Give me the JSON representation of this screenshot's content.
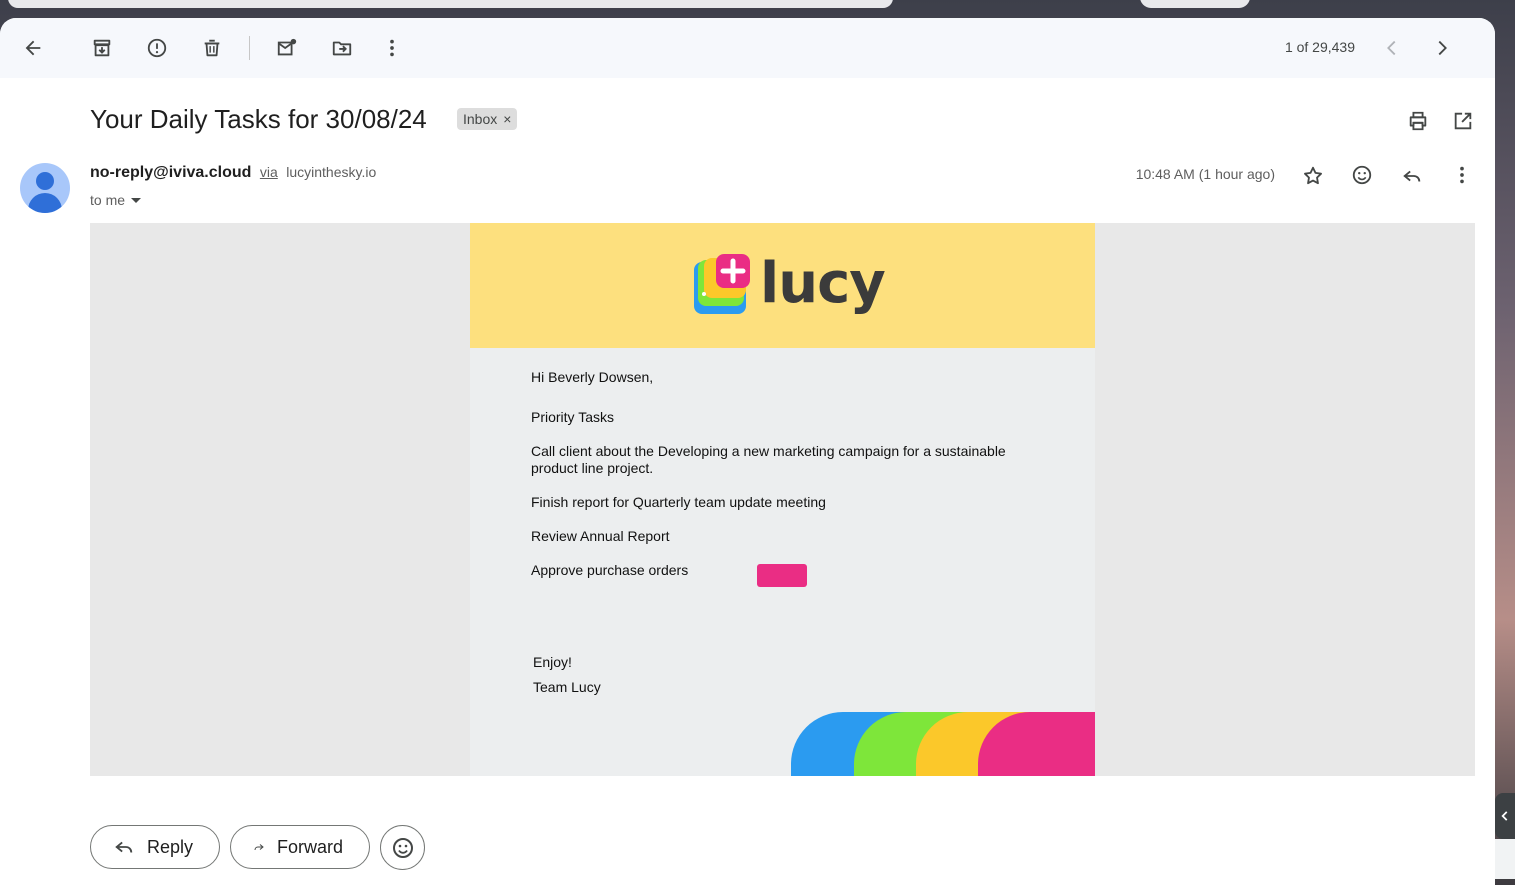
{
  "toolbar": {
    "back": "back-arrow-icon",
    "archive": "archive-icon",
    "report_spam": "report-spam-icon",
    "delete": "trash-icon",
    "mark_unread": "mark-unread-icon",
    "move_to": "move-to-icon",
    "more": "more-vert-icon",
    "pagination": "1 of 29,439",
    "newer": "chevron-left-icon",
    "older": "chevron-right-icon"
  },
  "message": {
    "subject": "Your Daily Tasks for 30/08/24",
    "label": "Inbox",
    "label_remove": "×",
    "sender_email": "no-reply@iviva.cloud",
    "via_text": "via",
    "via_domain": "lucyinthesky.io",
    "recipient": "to me",
    "timestamp": "10:48 AM (1 hour ago)"
  },
  "email": {
    "brand": "lucy",
    "greeting": "Hi Beverly Dowsen,",
    "heading": "Priority Tasks",
    "tasks": [
      "Call client about the Developing a new marketing campaign for a sustainable product line project.",
      "Finish report for Quarterly team update meeting",
      "Review Annual Report",
      "Approve purchase orders"
    ],
    "signoff": "Enjoy!",
    "signature": "Team Lucy"
  },
  "actions": {
    "reply": "Reply",
    "forward": "Forward"
  },
  "colors": {
    "banner": "#fde07e",
    "accent_pink": "#ea2d84",
    "deco": [
      "#2b9bf0",
      "#7ee63a",
      "#fbc82a",
      "#ea2d84"
    ]
  }
}
